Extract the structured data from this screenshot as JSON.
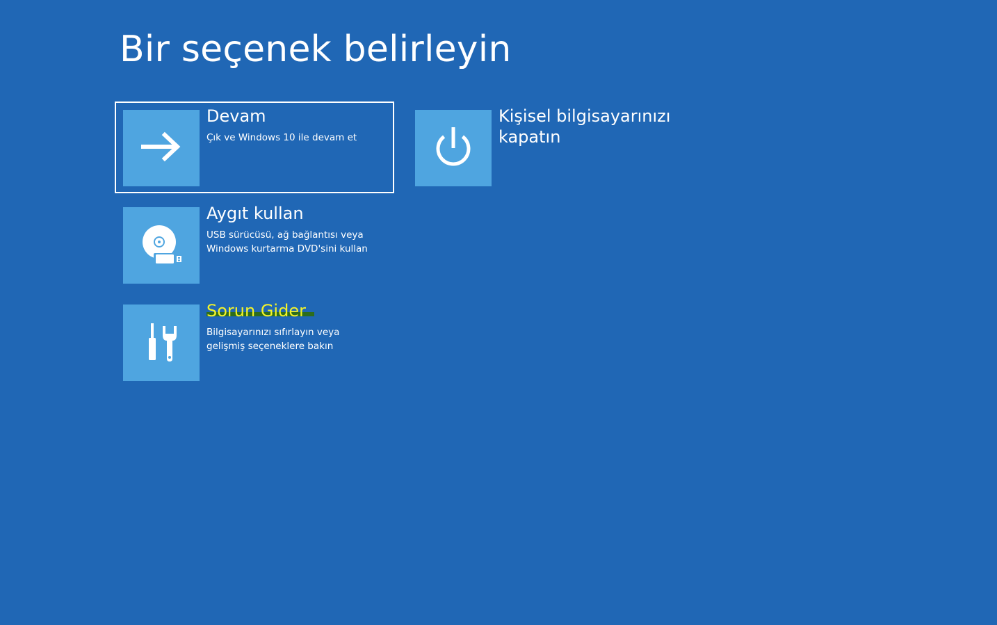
{
  "screen": {
    "title": "Bir seçenek belirleyin",
    "background_color": "#2067b5",
    "tile_color": "#4fa5e0"
  },
  "options": [
    {
      "title": "Devam",
      "description": "Çık ve Windows 10 ile devam et",
      "icon": "arrow-right-icon",
      "selected": true
    },
    {
      "title": "Kişisel bilgisayarınızı kapatın",
      "description": "",
      "icon": "power-icon",
      "selected": false
    },
    {
      "title": "Aygıt kullan",
      "description": "USB sürücüsü, ağ bağlantısı veya Windows kurtarma DVD'sini kullan",
      "icon": "disc-usb-icon",
      "selected": false
    },
    {
      "title": "Sorun Gider",
      "description": "Bilgisayarınızı sıfırlayın veya gelişmiş seçeneklere bakın",
      "icon": "tools-icon",
      "selected": false,
      "highlight_color": "#f3f32a"
    }
  ]
}
